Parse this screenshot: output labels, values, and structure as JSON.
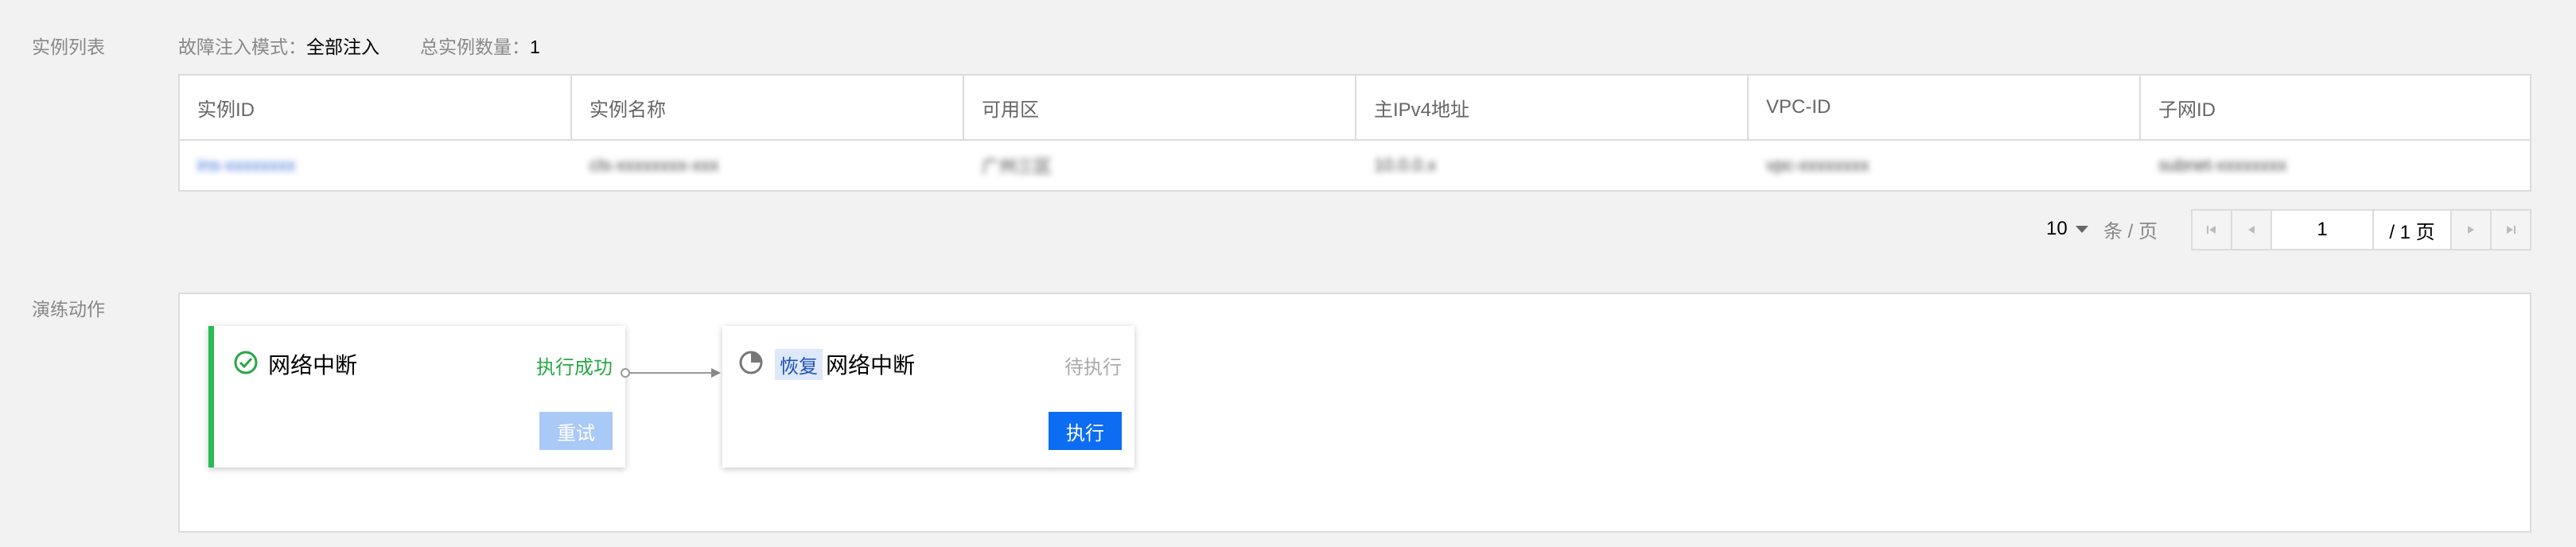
{
  "instances": {
    "section_label": "实例列表",
    "mode_label": "故障注入模式：",
    "mode_value": "全部注入",
    "total_label": "总实例数量：",
    "total_value": "1",
    "columns": [
      "实例ID",
      "实例名称",
      "可用区",
      "主IPv4地址",
      "VPC-ID",
      "子网ID"
    ],
    "rows": [
      [
        "ins-xxxxxxxx",
        "cls-xxxxxxxx-xxx",
        "广州三区",
        "10.0.0.x",
        "vpc-xxxxxxxx",
        "subnet-xxxxxxxx"
      ]
    ]
  },
  "pagination": {
    "page_size": "10",
    "per_page_label": "条 / 页",
    "current_page": "1",
    "total_pages": "/ 1 页"
  },
  "actions": {
    "section_label": "演练动作",
    "steps": [
      {
        "title": "网络中断",
        "status": "执行成功",
        "button": "重试",
        "status_color": "#29a745",
        "accent": "#29bb54"
      },
      {
        "tag": "恢复",
        "title": "网络中断",
        "status": "待执行",
        "button": "执行",
        "status_color": "#aaaaaa"
      }
    ]
  },
  "colors": {
    "primary": "#0c6cf2",
    "disabled": "#a9c9f7",
    "success": "#29a745"
  }
}
